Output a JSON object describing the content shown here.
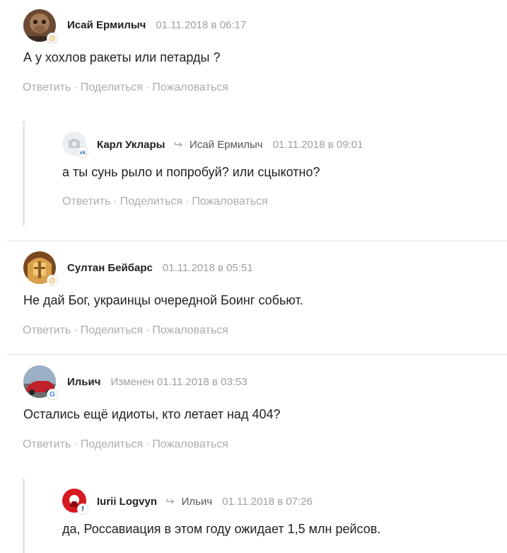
{
  "comments": [
    {
      "author": "Исай Ермилыч",
      "date": "01.11.2018 в 06:17",
      "text": "А у хохлов ракеты или петарды ?",
      "badge": "@",
      "badge_color": "#e8a23a"
    },
    {
      "author": "Карл Уклары",
      "reply_to": "Исай Ермилыч",
      "date": "01.11.2018 в 09:01",
      "text": "а ты сунь рыло и попробуй? или сцыкотно?",
      "badge": "vk",
      "badge_color": "#4a76a8"
    },
    {
      "author": "Султан Бейбарс",
      "date": "01.11.2018 в 05:51",
      "text": "Не дай Бог, украинцы очередной Боинг собьют.",
      "badge": "@",
      "badge_color": "#e8a23a"
    },
    {
      "author": "Ильич",
      "date": "Изменен 01.11.2018 в 03:53",
      "text": "Остались ещё идиоты, кто летает над 404?",
      "badge": "G",
      "badge_color": "#4285f4"
    },
    {
      "author": "Iurii Logvyn",
      "reply_to": "Ильич",
      "date": "01.11.2018 в 07:26",
      "text": "да, Россавиация в этом году ожидает 1,5 млн рейсов.",
      "badge": "f",
      "badge_color": "#3b5998"
    }
  ],
  "actions": {
    "reply": "Ответить",
    "share": "Поделиться",
    "report": "Пожаловаться",
    "separator": "·"
  }
}
